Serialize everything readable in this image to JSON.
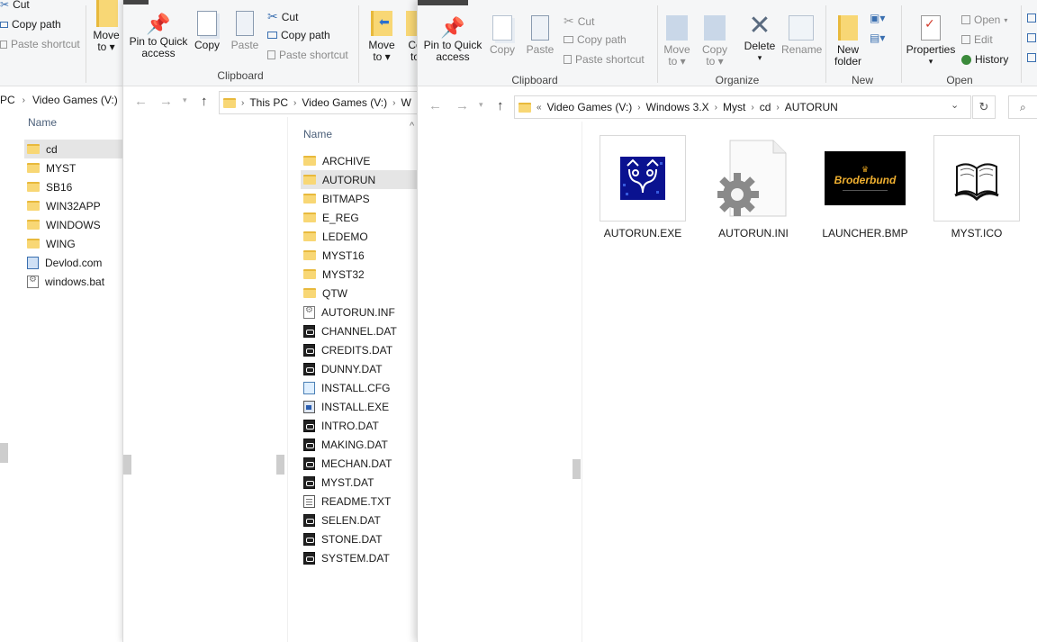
{
  "w1": {
    "ribbon": {
      "cut": "Cut",
      "copy_path": "Copy path",
      "paste_shortcut": "Paste shortcut",
      "move_to_1": "Move",
      "move_to_2": "to"
    },
    "breadcrumb": [
      "PC",
      "Video Games (V:)"
    ],
    "col_name": "Name",
    "items": [
      {
        "name": "cd",
        "icon": "folder-icon",
        "selected": true
      },
      {
        "name": "MYST",
        "icon": "folder-icon"
      },
      {
        "name": "SB16",
        "icon": "folder-icon"
      },
      {
        "name": "WIN32APP",
        "icon": "folder-icon"
      },
      {
        "name": "WINDOWS",
        "icon": "folder-icon"
      },
      {
        "name": "WING",
        "icon": "folder-icon"
      },
      {
        "name": "Devlod.com",
        "icon": "web-file-icon"
      },
      {
        "name": "windows.bat",
        "icon": "batch-file-icon"
      }
    ]
  },
  "w2": {
    "ribbon": {
      "pin_1": "Pin to Quick",
      "pin_2": "access",
      "copy": "Copy",
      "paste": "Paste",
      "cut": "Cut",
      "copy_path": "Copy path",
      "paste_shortcut": "Paste shortcut",
      "move_1": "Move",
      "move_2": "to",
      "co_1": "Co",
      "co_2": "to",
      "group_clipboard": "Clipboard"
    },
    "breadcrumb": [
      "This PC",
      "Video Games (V:)",
      "W"
    ],
    "col_name": "Name",
    "items": [
      {
        "name": "ARCHIVE",
        "icon": "folder-icon"
      },
      {
        "name": "AUTORUN",
        "icon": "folder-icon",
        "selected": true
      },
      {
        "name": "BITMAPS",
        "icon": "folder-icon"
      },
      {
        "name": "E_REG",
        "icon": "folder-icon"
      },
      {
        "name": "LEDEMO",
        "icon": "folder-icon"
      },
      {
        "name": "MYST16",
        "icon": "folder-icon"
      },
      {
        "name": "MYST32",
        "icon": "folder-icon"
      },
      {
        "name": "QTW",
        "icon": "folder-icon"
      },
      {
        "name": "AUTORUN.INF",
        "icon": "settings-file-icon"
      },
      {
        "name": "CHANNEL.DAT",
        "icon": "data-file-icon"
      },
      {
        "name": "CREDITS.DAT",
        "icon": "data-file-icon"
      },
      {
        "name": "DUNNY.DAT",
        "icon": "data-file-icon"
      },
      {
        "name": "INSTALL.CFG",
        "icon": "config-file-icon"
      },
      {
        "name": "INSTALL.EXE",
        "icon": "exe-file-icon"
      },
      {
        "name": "INTRO.DAT",
        "icon": "data-file-icon"
      },
      {
        "name": "MAKING.DAT",
        "icon": "data-file-icon"
      },
      {
        "name": "MECHAN.DAT",
        "icon": "data-file-icon"
      },
      {
        "name": "MYST.DAT",
        "icon": "data-file-icon"
      },
      {
        "name": "README.TXT",
        "icon": "text-file-icon"
      },
      {
        "name": "SELEN.DAT",
        "icon": "data-file-icon"
      },
      {
        "name": "STONE.DAT",
        "icon": "data-file-icon"
      },
      {
        "name": "SYSTEM.DAT",
        "icon": "data-file-icon"
      }
    ]
  },
  "w3": {
    "ribbon": {
      "pin_1": "Pin to Quick",
      "pin_2": "access",
      "copy": "Copy",
      "paste": "Paste",
      "cut": "Cut",
      "copy_path": "Copy path",
      "paste_shortcut": "Paste shortcut",
      "move_1": "Move",
      "move_2": "to",
      "copy_to_1": "Copy",
      "copy_to_2": "to",
      "delete": "Delete",
      "rename": "Rename",
      "new_folder_1": "New",
      "new_folder_2": "folder",
      "properties": "Properties",
      "open": "Open",
      "edit": "Edit",
      "history": "History",
      "group_clipboard": "Clipboard",
      "group_organize": "Organize",
      "group_new": "New",
      "group_open": "Open"
    },
    "breadcrumb": [
      "Video Games (V:)",
      "Windows 3.X",
      "Myst",
      "cd",
      "AUTORUN"
    ],
    "breadcrumb_overflow": "«",
    "tiles": [
      {
        "name": "AUTORUN.EXE",
        "icon": "autorun-exe-icon"
      },
      {
        "name": "AUTORUN.INI",
        "icon": "settings-file-icon"
      },
      {
        "name": "LAUNCHER.BMP",
        "icon": "broderbund-logo-thumbnail",
        "logo_text": "Broderbund"
      },
      {
        "name": "MYST.ICO",
        "icon": "book-icon"
      }
    ]
  }
}
